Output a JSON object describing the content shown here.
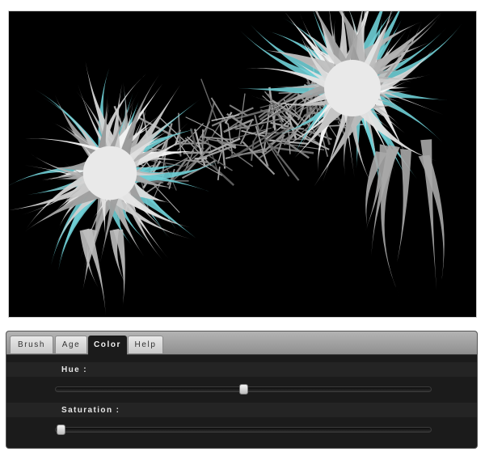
{
  "tabs": [
    {
      "label": "Brush",
      "active": false
    },
    {
      "label": "Age",
      "active": false
    },
    {
      "label": "Color",
      "active": true
    },
    {
      "label": "Help",
      "active": false
    }
  ],
  "controls": {
    "hue": {
      "label": "Hue :",
      "value": 0.5
    },
    "saturation": {
      "label": "Saturation :",
      "value": 0.0
    }
  },
  "colors": {
    "accent": "#6fcfd6",
    "spike_light": "#e4e4e4",
    "spike_mid": "#a9a9a9",
    "background": "#000000"
  }
}
